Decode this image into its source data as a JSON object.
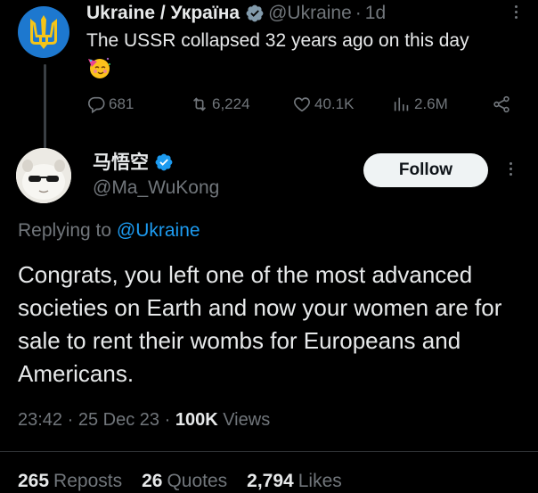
{
  "parent": {
    "name": "Ukraine / Україна",
    "handle": "@Ukraine",
    "dot": "·",
    "time": "1d",
    "text": "The USSR collapsed 32 years ago on this day",
    "emoji": "🥳",
    "counts": {
      "replies": "681",
      "reposts": "6,224",
      "likes": "40.1K",
      "views": "2.6M"
    }
  },
  "reply": {
    "name": "马悟空",
    "handle": "@Ma_WuKong",
    "follow_label": "Follow",
    "replying_prefix": "Replying to",
    "replying_to": "@Ukraine",
    "text": "Congrats, you left one of the most advanced societies on Earth and now your women are for sale to rent their wombs for Europeans and Americans.",
    "time": "23:42",
    "dot": "·",
    "date": "25 Dec 23",
    "views_count": "100K",
    "views_label": "Views",
    "reposts_count": "265",
    "reposts_label": "Reposts",
    "quotes_count": "26",
    "quotes_label": "Quotes",
    "likes_count": "2,794",
    "likes_label": "Likes"
  },
  "colors": {
    "background": "#000000",
    "text": "#e7e9ea",
    "muted": "#71767b",
    "accent": "#1d9bf0",
    "ukraine_blue": "#1d78cf",
    "ukraine_gold": "#f5c518"
  },
  "icons": [
    "trident-icon",
    "verified-gray-icon",
    "verified-blue-icon",
    "reply-icon",
    "repost-icon",
    "like-icon",
    "views-icon",
    "share-icon",
    "more-icon"
  ]
}
